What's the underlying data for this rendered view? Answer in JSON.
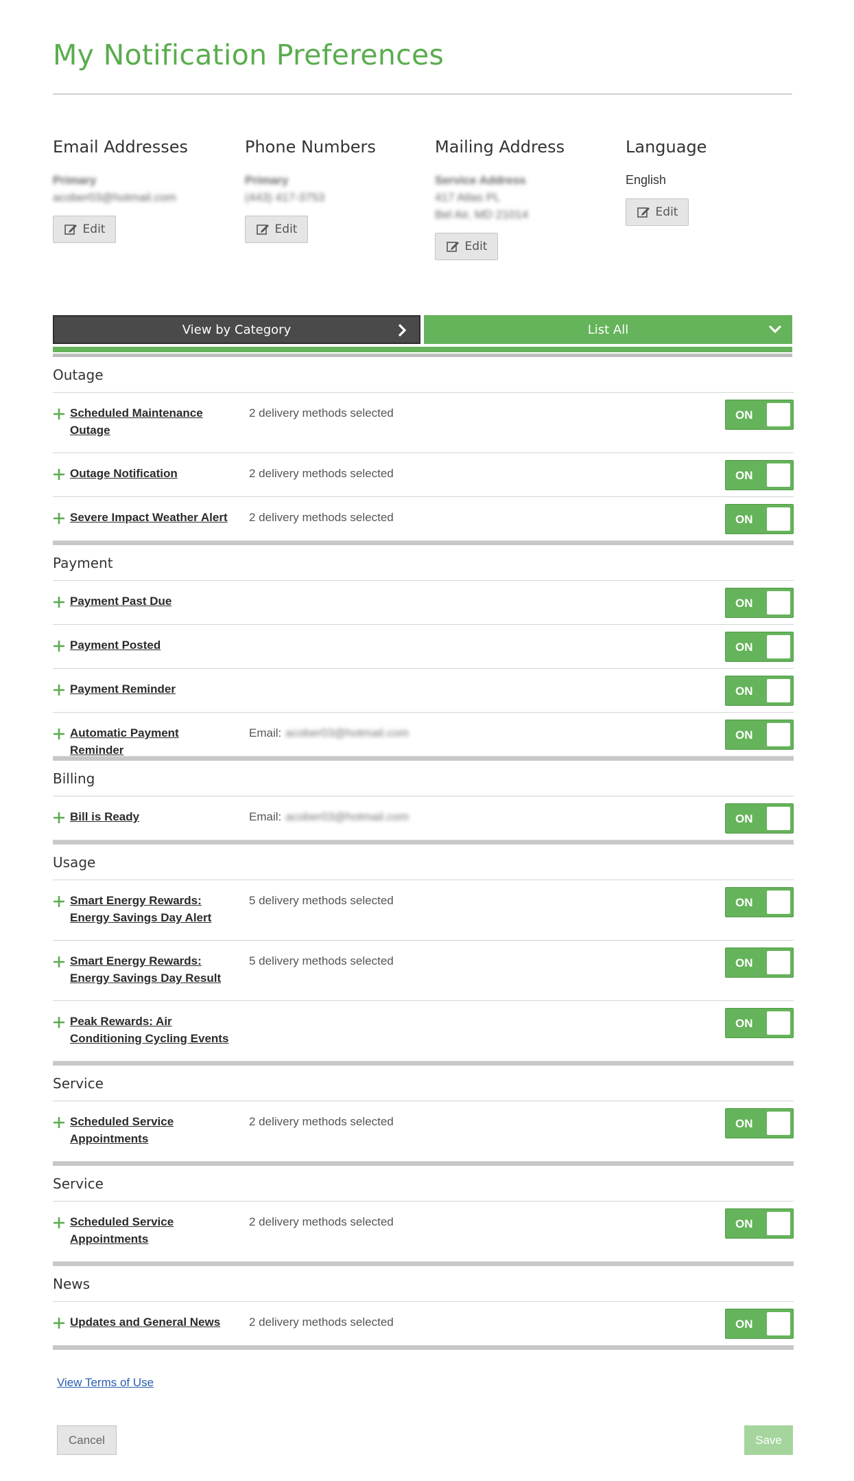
{
  "page_title": "My Notification Preferences",
  "contacts": [
    {
      "heading": "Email Addresses",
      "lines": [
        {
          "text": "Primary",
          "bold": true
        },
        {
          "text": "acober03@hotmail.com",
          "bold": false
        }
      ],
      "edit_label": "Edit"
    },
    {
      "heading": "Phone Numbers",
      "lines": [
        {
          "text": "Primary",
          "bold": true
        },
        {
          "text": "(443) 417-3753",
          "bold": false
        }
      ],
      "edit_label": "Edit"
    },
    {
      "heading": "Mailing Address",
      "lines": [
        {
          "text": "Service Address",
          "bold": true
        },
        {
          "text": "417 Atlas PL",
          "bold": false
        },
        {
          "text": "Bel Air, MD 21014",
          "bold": false
        }
      ],
      "edit_label": "Edit"
    },
    {
      "heading": "Language",
      "value": "English",
      "edit_label": "Edit"
    }
  ],
  "tabs": {
    "category": "View by Category",
    "list_all": "List All"
  },
  "sections": [
    {
      "title": "Outage",
      "items": [
        {
          "name": "Scheduled Maintenance Outage",
          "detail": "2 delivery methods selected",
          "toggle": "ON"
        },
        {
          "name": "Outage Notification",
          "detail": "2 delivery methods selected",
          "toggle": "ON"
        },
        {
          "name": "Severe Impact Weather Alert",
          "detail": "2 delivery methods selected",
          "toggle": "ON"
        }
      ]
    },
    {
      "title": "Payment",
      "items": [
        {
          "name": "Payment Past Due",
          "detail": "",
          "toggle": "ON"
        },
        {
          "name": "Payment Posted",
          "detail": "",
          "toggle": "ON"
        },
        {
          "name": "Payment Reminder",
          "detail": "",
          "toggle": "ON"
        },
        {
          "name": "Automatic Payment Reminder",
          "detail": "Email:",
          "email": "acober03@hotmail.com",
          "toggle": "ON"
        }
      ]
    },
    {
      "title": "Billing",
      "items": [
        {
          "name": "Bill is Ready",
          "detail": "Email:",
          "email": "acober03@hotmail.com",
          "toggle": "ON"
        }
      ]
    },
    {
      "title": "Usage",
      "items": [
        {
          "name": "Smart Energy Rewards: Energy Savings Day Alert",
          "detail": "5 delivery methods selected",
          "toggle": "ON"
        },
        {
          "name": "Smart Energy Rewards: Energy Savings Day Result",
          "detail": "5 delivery methods selected",
          "toggle": "ON"
        },
        {
          "name": "Peak Rewards: Air Conditioning Cycling Events",
          "detail": "",
          "toggle": "ON"
        }
      ]
    },
    {
      "title": "Service",
      "items": [
        {
          "name": "Scheduled Service Appointments",
          "detail": "2 delivery methods selected",
          "toggle": "ON"
        }
      ]
    },
    {
      "title": "Service",
      "items": [
        {
          "name": "Scheduled Service Appointments",
          "detail": "2 delivery methods selected",
          "toggle": "ON"
        }
      ]
    },
    {
      "title": "News",
      "items": [
        {
          "name": "Updates and General News",
          "detail": "2 delivery methods selected",
          "toggle": "ON"
        }
      ]
    }
  ],
  "terms_link": "View Terms of Use",
  "cancel_label": "Cancel",
  "save_label": "Save",
  "colors": {
    "brand_green": "#5aac4e",
    "toggle_green": "#65b35a",
    "dark_tab": "#4a4a4a",
    "link_blue": "#2a5db0"
  }
}
